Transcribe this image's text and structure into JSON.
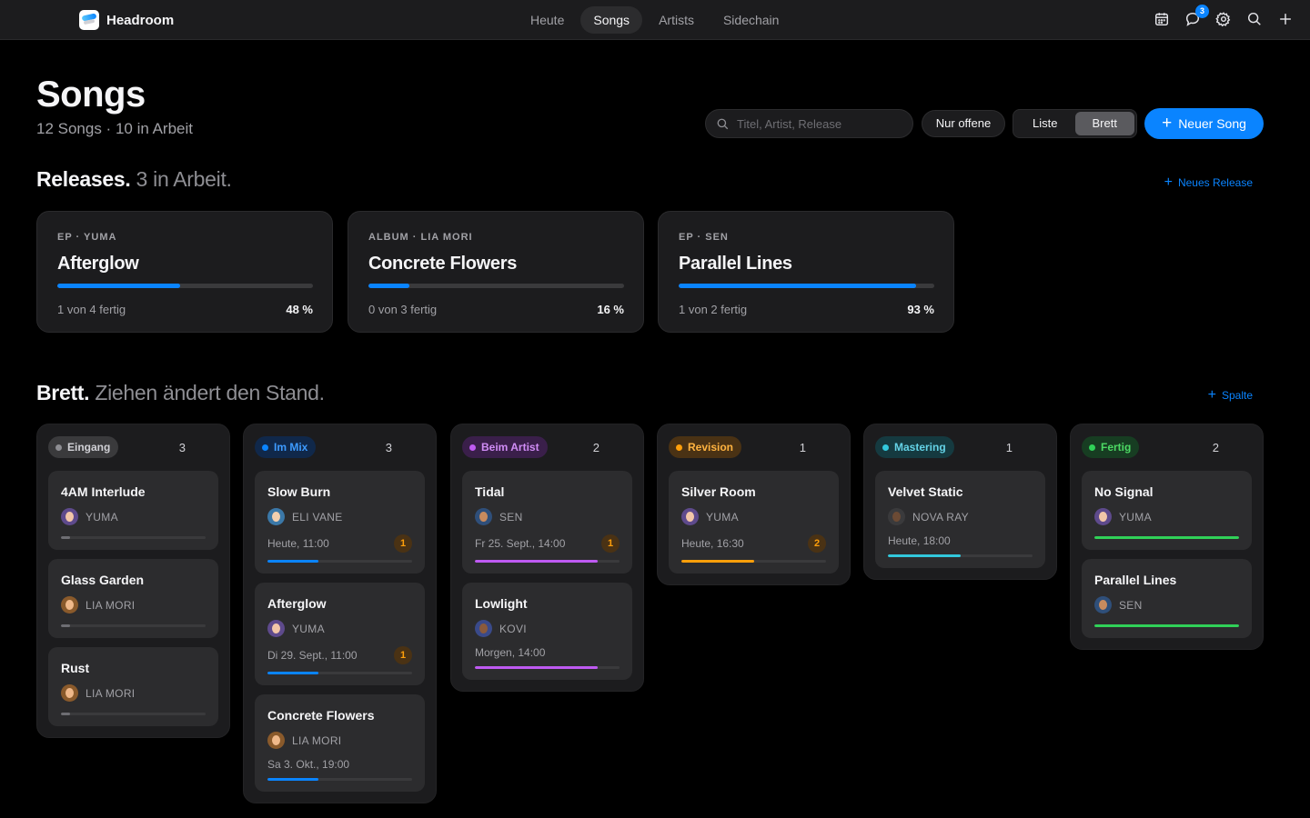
{
  "app": {
    "name": "Headroom"
  },
  "nav": {
    "items": [
      "Heute",
      "Songs",
      "Artists",
      "Sidechain"
    ],
    "active_index": 1
  },
  "notifications": {
    "count": "3"
  },
  "header": {
    "title": "Songs",
    "subtitle": "12 Songs · 10 in Arbeit",
    "search_placeholder": "Titel, Artist, Release",
    "filter_label": "Nur offene",
    "view_toggle": {
      "options": [
        "Liste",
        "Brett"
      ],
      "selected": "Brett"
    },
    "new_song_label": "Neuer Song"
  },
  "releases": {
    "heading": "Releases.",
    "heading_muted": "3 in Arbeit.",
    "new_release_label": "Neues Release",
    "cards": [
      {
        "kicker": "EP · YUMA",
        "title": "Afterglow",
        "progress_text": "1 von 4 fertig",
        "percent_label": "48 %",
        "percent": 48
      },
      {
        "kicker": "ALBUM · LIA MORI",
        "title": "Concrete Flowers",
        "progress_text": "0 von 3 fertig",
        "percent_label": "16 %",
        "percent": 16
      },
      {
        "kicker": "EP · SEN",
        "title": "Parallel Lines",
        "progress_text": "1 von 2 fertig",
        "percent_label": "93 %",
        "percent": 93
      }
    ]
  },
  "board": {
    "heading": "Brett.",
    "heading_muted": "Ziehen ändert den Stand.",
    "add_column_label": "Spalte",
    "columns": [
      {
        "label": "Eingang",
        "count": "3",
        "color": "#8e8e93",
        "pill_bg": "#3a3a3c",
        "pill_text": "#d1d1d6",
        "cards": [
          {
            "title": "4AM Interlude",
            "artist": "YUMA",
            "avatar": "yuma",
            "progress": 0.06
          },
          {
            "title": "Glass Garden",
            "artist": "LIA MORI",
            "avatar": "lia",
            "progress": 0.06
          },
          {
            "title": "Rust",
            "artist": "LIA MORI",
            "avatar": "lia",
            "progress": 0.06
          }
        ]
      },
      {
        "label": "Im Mix",
        "count": "3",
        "color": "#0a84ff",
        "pill_bg": "#10284a",
        "pill_text": "#3d9bff",
        "cards": [
          {
            "title": "Slow Burn",
            "artist": "ELI VANE",
            "avatar": "eli",
            "meta": "Heute, 11:00",
            "comments": "1",
            "progress": 0.35
          },
          {
            "title": "Afterglow",
            "artist": "YUMA",
            "avatar": "yuma",
            "meta": "Di 29. Sept., 11:00",
            "comments": "1",
            "progress": 0.35
          },
          {
            "title": "Concrete Flowers",
            "artist": "LIA MORI",
            "avatar": "lia",
            "meta": "Sa 3. Okt., 19:00",
            "progress": 0.35
          }
        ]
      },
      {
        "label": "Beim Artist",
        "count": "2",
        "color": "#bf5af2",
        "pill_bg": "#3a1f4a",
        "pill_text": "#d08cf5",
        "cards": [
          {
            "title": "Tidal",
            "artist": "SEN",
            "avatar": "sen",
            "meta": "Fr 25. Sept., 14:00",
            "comments": "1",
            "progress": 0.85
          },
          {
            "title": "Lowlight",
            "artist": "KOVI",
            "avatar": "kovi",
            "meta": "Morgen, 14:00",
            "progress": 0.85
          }
        ]
      },
      {
        "label": "Revision",
        "count": "1",
        "color": "#ff9f0a",
        "pill_bg": "#4a3214",
        "pill_text": "#ffb340",
        "cards": [
          {
            "title": "Silver Room",
            "artist": "YUMA",
            "avatar": "yuma",
            "meta": "Heute, 16:30",
            "comments": "2",
            "progress": 0.5
          }
        ]
      },
      {
        "label": "Mastering",
        "count": "1",
        "color": "#32c8dc",
        "pill_bg": "#153a40",
        "pill_text": "#64d2e6",
        "cards": [
          {
            "title": "Velvet Static",
            "artist": "NOVA RAY",
            "avatar": "nova",
            "meta": "Heute, 18:00",
            "progress": 0.5
          }
        ]
      },
      {
        "label": "Fertig",
        "count": "2",
        "color": "#30d158",
        "pill_bg": "#173d22",
        "pill_text": "#4cd964",
        "cards": [
          {
            "title": "No Signal",
            "artist": "YUMA",
            "avatar": "yuma",
            "progress": 1
          },
          {
            "title": "Parallel Lines",
            "artist": "SEN",
            "avatar": "sen",
            "progress": 1
          }
        ]
      }
    ]
  },
  "colors": {
    "accent": "#0a84ff",
    "background": "#000000",
    "surface": "#1c1c1e",
    "card": "#2c2c2e"
  }
}
